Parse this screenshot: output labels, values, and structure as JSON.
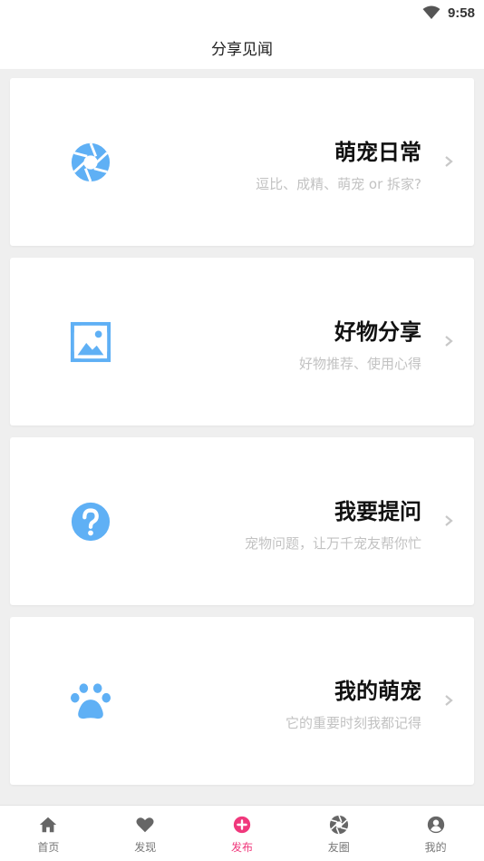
{
  "status_bar": {
    "time": "9:58"
  },
  "header": {
    "title": "分享见闻"
  },
  "cards": [
    {
      "title": "萌宠日常",
      "subtitle": "逗比、成精、萌宠 or 拆家?",
      "icon": "camera-aperture-icon"
    },
    {
      "title": "好物分享",
      "subtitle": "好物推荐、使用心得",
      "icon": "picture-frame-icon"
    },
    {
      "title": "我要提问",
      "subtitle": "宠物问题，让万千宠友帮你忙",
      "icon": "question-mark-icon"
    },
    {
      "title": "我的萌宠",
      "subtitle": "它的重要时刻我都记得",
      "icon": "paw-icon"
    }
  ],
  "tabs": [
    {
      "label": "首页",
      "icon": "home-icon"
    },
    {
      "label": "发现",
      "icon": "heart-icon"
    },
    {
      "label": "发布",
      "icon": "plus-circle-icon",
      "active": true
    },
    {
      "label": "友圈",
      "icon": "aperture-icon"
    },
    {
      "label": "我的",
      "icon": "user-icon"
    }
  ],
  "colors": {
    "accent_blue": "#5fb0f5",
    "active_pink": "#f0387c",
    "subtitle_gray": "#c2c2c2"
  }
}
